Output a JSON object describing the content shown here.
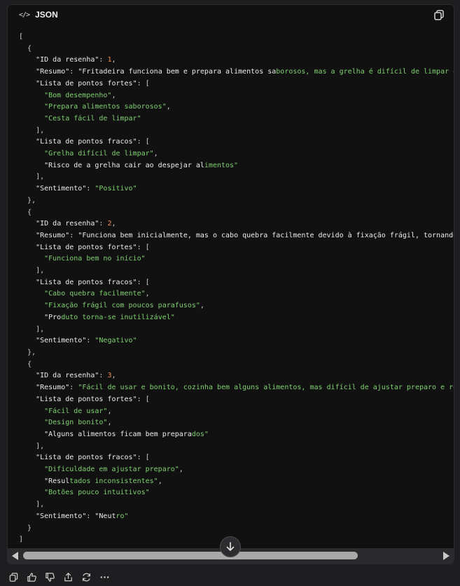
{
  "code_block": {
    "language_icon": "</>",
    "language": "JSON"
  },
  "code_lines": [
    [
      [
        "p",
        "["
      ]
    ],
    [
      [
        "p",
        "  {"
      ]
    ],
    [
      [
        "p",
        "    "
      ],
      [
        "k",
        "\"ID da resenha\""
      ],
      [
        "p",
        ": "
      ],
      [
        "n",
        "1"
      ],
      [
        "p",
        ","
      ]
    ],
    [
      [
        "p",
        "    "
      ],
      [
        "k",
        "\"Resumo\""
      ],
      [
        "p",
        ": "
      ],
      [
        "k",
        "\"Fritadeira funciona bem e prepara alimentos sa"
      ],
      [
        "s",
        "borosos, mas a grelha é difícil de limpar e insegura.\""
      ]
    ],
    [
      [
        "p",
        "    "
      ],
      [
        "k",
        "\"Lista de pontos fortes\""
      ],
      [
        "p",
        ": ["
      ]
    ],
    [
      [
        "p",
        "      "
      ],
      [
        "s",
        "\"Bom desempenho\""
      ],
      [
        "p",
        ","
      ]
    ],
    [
      [
        "p",
        "      "
      ],
      [
        "s",
        "\"Prepara alimentos saborosos\""
      ],
      [
        "p",
        ","
      ]
    ],
    [
      [
        "p",
        "      "
      ],
      [
        "s",
        "\"Cesta fácil de limpar\""
      ]
    ],
    [
      [
        "p",
        "    ],"
      ]
    ],
    [
      [
        "p",
        "    "
      ],
      [
        "k",
        "\"Lista de pontos fracos\""
      ],
      [
        "p",
        ": ["
      ]
    ],
    [
      [
        "p",
        "      "
      ],
      [
        "s",
        "\"Grelha difícil de limpar\""
      ],
      [
        "p",
        ","
      ]
    ],
    [
      [
        "p",
        "      "
      ],
      [
        "k",
        "\"Risco de a grelha cair ao despejar al"
      ],
      [
        "s",
        "imentos\""
      ]
    ],
    [
      [
        "p",
        "    ],"
      ]
    ],
    [
      [
        "p",
        "    "
      ],
      [
        "k",
        "\"Sentimento\""
      ],
      [
        "p",
        ": "
      ],
      [
        "s",
        "\"Positivo\""
      ]
    ],
    [
      [
        "p",
        "  },"
      ]
    ],
    [
      [
        "p",
        "  {"
      ]
    ],
    [
      [
        "p",
        "    "
      ],
      [
        "k",
        "\"ID da resenha\""
      ],
      [
        "p",
        ": "
      ],
      [
        "n",
        "2"
      ],
      [
        "p",
        ","
      ]
    ],
    [
      [
        "p",
        "    "
      ],
      [
        "k",
        "\"Resumo\""
      ],
      [
        "p",
        ": "
      ],
      [
        "k",
        "\"Funciona bem inicialmente, mas o cabo quebra facilmente devido à fixação frágil, tornando o produto inutilizável.\""
      ]
    ],
    [
      [
        "p",
        "    "
      ],
      [
        "k",
        "\"Lista de pontos fortes\""
      ],
      [
        "p",
        ": ["
      ]
    ],
    [
      [
        "p",
        "      "
      ],
      [
        "s",
        "\"Funciona bem no início\""
      ]
    ],
    [
      [
        "p",
        "    ],"
      ]
    ],
    [
      [
        "p",
        "    "
      ],
      [
        "k",
        "\"Lista de pontos fracos\""
      ],
      [
        "p",
        ": ["
      ]
    ],
    [
      [
        "p",
        "      "
      ],
      [
        "s",
        "\"Cabo quebra facilmente\""
      ],
      [
        "p",
        ","
      ]
    ],
    [
      [
        "p",
        "      "
      ],
      [
        "s",
        "\"Fixação frágil com poucos parafusos\""
      ],
      [
        "p",
        ","
      ]
    ],
    [
      [
        "p",
        "      "
      ],
      [
        "k",
        "\"Pro"
      ],
      [
        "s",
        "duto torna-se inutilizável\""
      ]
    ],
    [
      [
        "p",
        "    ],"
      ]
    ],
    [
      [
        "p",
        "    "
      ],
      [
        "k",
        "\"Sentimento\""
      ],
      [
        "p",
        ": "
      ],
      [
        "s",
        "\"Negativo\""
      ]
    ],
    [
      [
        "p",
        "  },"
      ]
    ],
    [
      [
        "p",
        "  {"
      ]
    ],
    [
      [
        "p",
        "    "
      ],
      [
        "k",
        "\"ID da resenha\""
      ],
      [
        "p",
        ": "
      ],
      [
        "n",
        "3"
      ],
      [
        "p",
        ","
      ]
    ],
    [
      [
        "p",
        "    "
      ],
      [
        "k",
        "\"Resumo\""
      ],
      [
        "p",
        ": "
      ],
      [
        "s",
        "\"Fácil de usar e bonito, cozinha bem alguns alimentos, mas difícil de ajustar preparo e resultados inconsistentes.\""
      ]
    ],
    [
      [
        "p",
        "    "
      ],
      [
        "k",
        "\"Lista de pontos fortes\""
      ],
      [
        "p",
        ": ["
      ]
    ],
    [
      [
        "p",
        "      "
      ],
      [
        "s",
        "\"Fácil de usar\""
      ],
      [
        "p",
        ","
      ]
    ],
    [
      [
        "p",
        "      "
      ],
      [
        "s",
        "\"Design bonito\""
      ],
      [
        "p",
        ","
      ]
    ],
    [
      [
        "p",
        "      "
      ],
      [
        "k",
        "\"Alguns alimentos ficam bem prepara"
      ],
      [
        "s",
        "dos\""
      ]
    ],
    [
      [
        "p",
        "    ],"
      ]
    ],
    [
      [
        "p",
        "    "
      ],
      [
        "k",
        "\"Lista de pontos fracos\""
      ],
      [
        "p",
        ": ["
      ]
    ],
    [
      [
        "p",
        "      "
      ],
      [
        "s",
        "\"Dificuldade em ajustar preparo\""
      ],
      [
        "p",
        ","
      ]
    ],
    [
      [
        "p",
        "      "
      ],
      [
        "k",
        "\"Resul"
      ],
      [
        "s",
        "tados inconsistentes\""
      ],
      [
        "p",
        ","
      ]
    ],
    [
      [
        "p",
        "      "
      ],
      [
        "s",
        "\"Botões pouco intuitivos\""
      ]
    ],
    [
      [
        "p",
        "    ],"
      ]
    ],
    [
      [
        "p",
        "    "
      ],
      [
        "k",
        "\"Sentimento\""
      ],
      [
        "p",
        ": "
      ],
      [
        "k",
        "\"Neut"
      ],
      [
        "s",
        "ro\""
      ]
    ],
    [
      [
        "p",
        "  }"
      ]
    ],
    [
      [
        "p",
        "]"
      ]
    ]
  ],
  "icons": {
    "copy": "copy-icon",
    "scroll_down": "arrow-down-icon",
    "actions": [
      "copy-icon",
      "thumbs-up-icon",
      "thumbs-down-icon",
      "share-icon",
      "regenerate-icon",
      "more-icon"
    ]
  },
  "colors": {
    "key": "#ececec",
    "string": "#7fd16f",
    "number": "#f08a57",
    "background": "#111112"
  }
}
